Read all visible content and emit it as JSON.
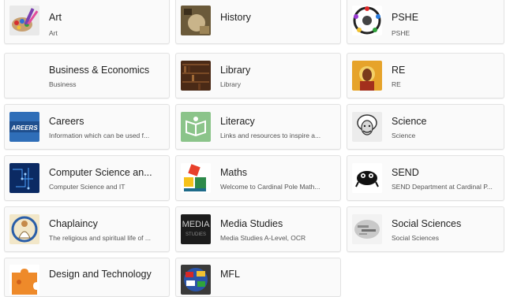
{
  "subjects": [
    {
      "title": "Art",
      "subtitle": "Art",
      "icon": "art-palette-icon"
    },
    {
      "title": "History",
      "subtitle": "",
      "icon": "history-image-icon"
    },
    {
      "title": "PSHE",
      "subtitle": "PSHE",
      "icon": "pshe-wheel-icon"
    },
    {
      "title": "Business & Economics",
      "subtitle": "Business",
      "icon": ""
    },
    {
      "title": "Library",
      "subtitle": "Library",
      "icon": "library-books-icon"
    },
    {
      "title": "RE",
      "subtitle": "RE",
      "icon": "re-icon-image"
    },
    {
      "title": "Careers",
      "subtitle": "Information which can be used f...",
      "icon": "careers-sign-icon"
    },
    {
      "title": "Literacy",
      "subtitle": "Links and resources to inspire a...",
      "icon": "literacy-book-icon"
    },
    {
      "title": "Science",
      "subtitle": "Science",
      "icon": "science-einstein-icon"
    },
    {
      "title": "Computer Science an...",
      "subtitle": "Computer Science and IT",
      "icon": "computer-circuit-icon"
    },
    {
      "title": "Maths",
      "subtitle": "Welcome to Cardinal Pole Math...",
      "icon": "maths-pythagoras-icon"
    },
    {
      "title": "SEND",
      "subtitle": "SEND Department at Cardinal P...",
      "icon": "send-creature-icon"
    },
    {
      "title": "Chaplaincy",
      "subtitle": "The religious and spiritual life of ...",
      "icon": "chaplaincy-figure-icon"
    },
    {
      "title": "Media Studies",
      "subtitle": "Media Studies A-Level, OCR",
      "icon": "media-text-icon"
    },
    {
      "title": "Social Sciences",
      "subtitle": "Social Sciences",
      "icon": "social-sciences-wordcloud-icon"
    },
    {
      "title": "Design and Technology",
      "subtitle": "",
      "icon": "design-puzzle-icon"
    },
    {
      "title": "MFL",
      "subtitle": "",
      "icon": "mfl-flags-icon"
    }
  ],
  "colors": {
    "card_bg": "#fafafa",
    "border": "#e2e2e2"
  }
}
